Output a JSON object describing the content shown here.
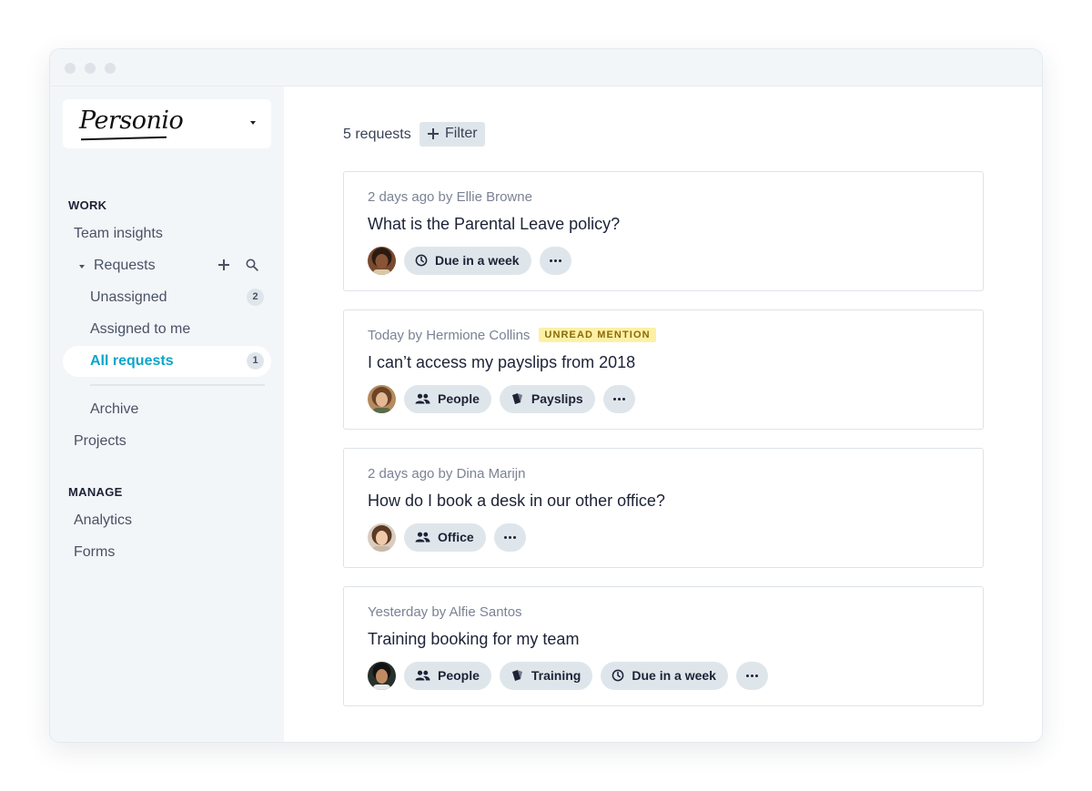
{
  "sidebar": {
    "logo_text": "Personio",
    "sections": {
      "work": "WORK",
      "manage": "MANAGE"
    },
    "items": {
      "team_insights": "Team insights",
      "requests": "Requests",
      "unassigned": "Unassigned",
      "unassigned_count": "2",
      "assigned_to_me": "Assigned to me",
      "all_requests": "All requests",
      "all_requests_count": "1",
      "archive": "Archive",
      "projects": "Projects",
      "analytics": "Analytics",
      "forms": "Forms"
    }
  },
  "main": {
    "request_count": "5 requests",
    "filter_label": "Filter",
    "requests": [
      {
        "meta": "2 days ago by Ellie Browne",
        "badge": "",
        "title": "What is the Parental Leave policy?",
        "tags": [
          "Due in a week"
        ]
      },
      {
        "meta": "Today by Hermione Collins",
        "badge": "UNREAD MENTION",
        "title": "I can’t access my payslips from 2018",
        "tags": [
          "People",
          "Payslips"
        ]
      },
      {
        "meta": "2 days ago by Dina Marijn",
        "badge": "",
        "title": "How do I book a desk in our other office?",
        "tags": [
          "Office"
        ]
      },
      {
        "meta": "Yesterday by Alfie Santos",
        "badge": "",
        "title": "Training booking for my team",
        "tags": [
          "People",
          "Training",
          "Due in a week"
        ]
      }
    ]
  },
  "colors": {
    "accent": "#0ba5c9",
    "badge_bg": "#fdf0a6",
    "tag_bg": "#dfe6eb"
  }
}
